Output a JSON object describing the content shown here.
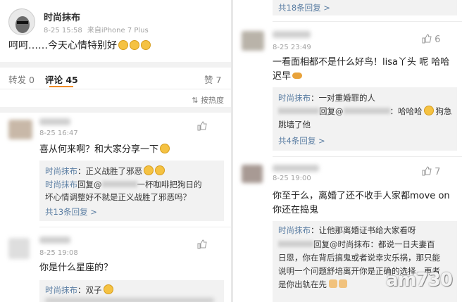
{
  "post": {
    "author": "时尚抹布",
    "time": "8-25 15:58",
    "source": "来自iPhone 7 Plus",
    "text": "呵呵……今天心情特别好"
  },
  "tabs": {
    "repost": "转发 0",
    "comments": "评论 45",
    "likes": "赞 7",
    "sort": "按热度"
  },
  "left_comments": [
    {
      "time": "8-25 16:47",
      "text": "喜从何来啊？和大家分享一下",
      "replies": [
        {
          "name": "时尚抹布",
          "text": "：正义战胜了邪恶"
        },
        {
          "name": "时尚抹布",
          "text": "回复@",
          "text2": "一杯咖啡把狗日的"
        },
        {
          "text": "坏心情调整好不就是正义战胜了邪恶吗？"
        }
      ],
      "more": "共13条回复 >"
    },
    {
      "time": "8-25 19:08",
      "text": "你是什么星座的？",
      "replies": [
        {
          "name": "时尚抹布",
          "text": "：双子"
        }
      ]
    }
  ],
  "right_comments": [
    {
      "more_top": "共18条回复 >",
      "like_count": "6",
      "time": "8-25 23:49",
      "text_line1": "一看面相都不是什么好鸟！lisa丫头 呢 哈哈",
      "text_line2": "迟早",
      "replies": [
        {
          "name": "时尚抹布",
          "text": "：一对重婚罪的人"
        },
        {
          "text": "回复@",
          "text2": "：哈哈哈",
          "text3": "狗急"
        },
        {
          "text": "跳墙了他"
        }
      ],
      "more": "共4条回复 >"
    },
    {
      "like_count": "7",
      "time": "8-25 19:00",
      "text_line1": "你至于么，离婚了还不收手人家都move on",
      "text_line2": "你还在捣鬼",
      "replies": [
        {
          "name": "时尚抹布",
          "text": "：让他那离婚证书给大家看呀"
        },
        {
          "text": "回复@时尚抹布：都说一日夫妻百"
        },
        {
          "text": "日恩，你在背后搞鬼或者说幸灾乐祸，那只能"
        },
        {
          "text": "说明一个问题舒培离开你是正确的选择，再者"
        },
        {
          "text": "是你出轨在先"
        }
      ]
    }
  ],
  "watermark": "am730",
  "colors": {
    "name": "#e0803b",
    "link": "#5b7ea3",
    "reply_bg": "#f2f2f2",
    "meta": "#a3a3a3"
  }
}
